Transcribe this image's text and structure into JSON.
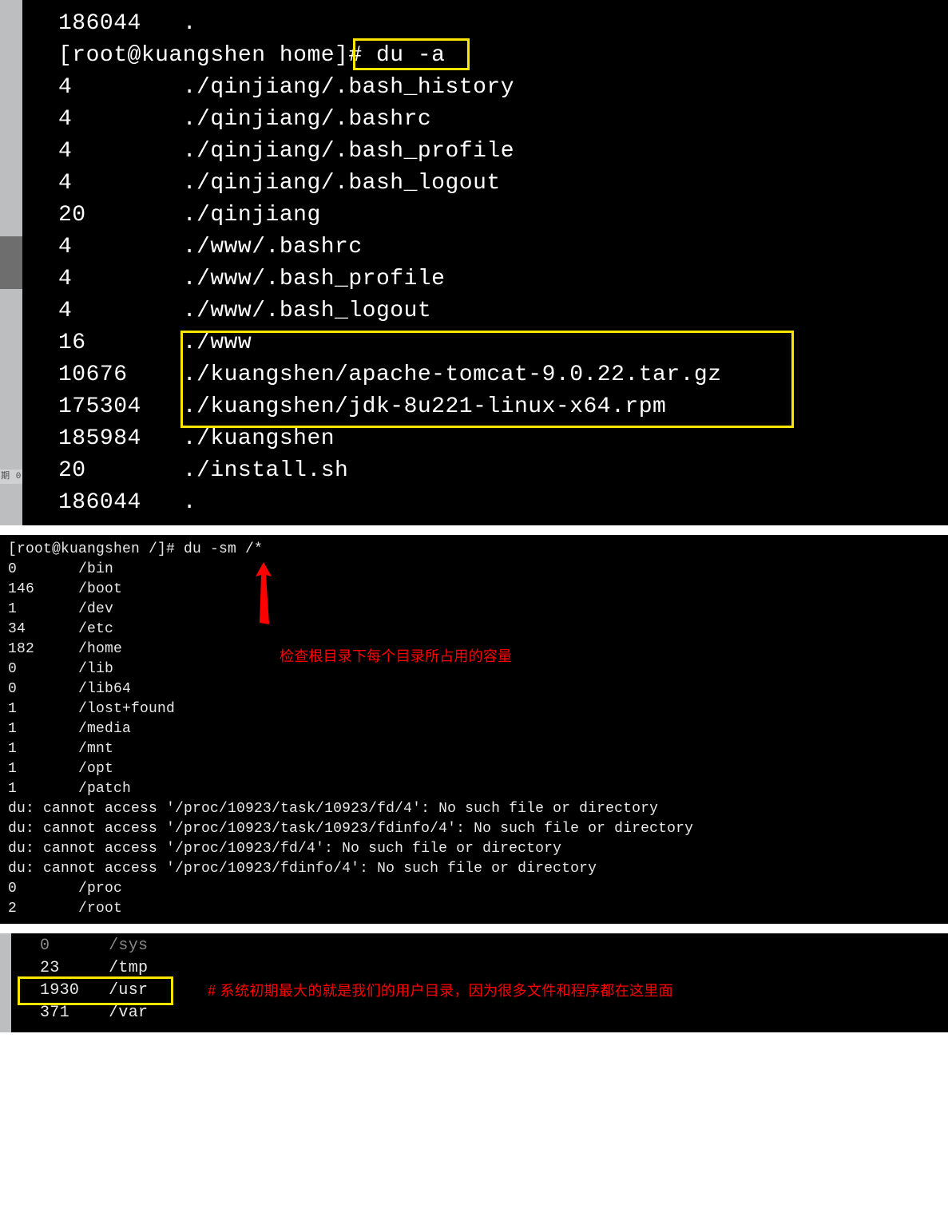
{
  "section1": {
    "sidebar_text": "期\n0",
    "lines": [
      {
        "size": "186044",
        "path": "."
      },
      {
        "prompt": "[root@kuangshen home]# ",
        "cmd": "du -a"
      },
      {
        "size": "4",
        "path": "./qinjiang/.bash_history"
      },
      {
        "size": "4",
        "path": "./qinjiang/.bashrc"
      },
      {
        "size": "4",
        "path": "./qinjiang/.bash_profile"
      },
      {
        "size": "4",
        "path": "./qinjiang/.bash_logout"
      },
      {
        "size": "20",
        "path": "./qinjiang"
      },
      {
        "size": "4",
        "path": "./www/.bashrc"
      },
      {
        "size": "4",
        "path": "./www/.bash_profile"
      },
      {
        "size": "4",
        "path": "./www/.bash_logout"
      },
      {
        "size": "16",
        "path": "./www"
      },
      {
        "size": "10676",
        "path": "./kuangshen/apache-tomcat-9.0.22.tar.gz"
      },
      {
        "size": "175304",
        "path": "./kuangshen/jdk-8u221-linux-x64.rpm"
      },
      {
        "size": "185984",
        "path": "./kuangshen"
      },
      {
        "size": "20",
        "path": "./install.sh"
      },
      {
        "size": "186044",
        "path": "."
      }
    ]
  },
  "section2": {
    "prompt": "[root@kuangshen /]# ",
    "cmd": "du -sm /*",
    "note": "检查根目录下每个目录所占用的容量",
    "rows": [
      {
        "size": "0",
        "path": "/bin"
      },
      {
        "size": "146",
        "path": "/boot"
      },
      {
        "size": "1",
        "path": "/dev"
      },
      {
        "size": "34",
        "path": "/etc"
      },
      {
        "size": "182",
        "path": "/home"
      },
      {
        "size": "0",
        "path": "/lib"
      },
      {
        "size": "0",
        "path": "/lib64"
      },
      {
        "size": "1",
        "path": "/lost+found"
      },
      {
        "size": "1",
        "path": "/media"
      },
      {
        "size": "1",
        "path": "/mnt"
      },
      {
        "size": "1",
        "path": "/opt"
      },
      {
        "size": "1",
        "path": "/patch"
      }
    ],
    "errors": [
      "du: cannot access '/proc/10923/task/10923/fd/4': No such file or directory",
      "du: cannot access '/proc/10923/task/10923/fdinfo/4': No such file or directory",
      "du: cannot access '/proc/10923/fd/4': No such file or directory",
      "du: cannot access '/proc/10923/fdinfo/4': No such file or directory"
    ],
    "rows2": [
      {
        "size": "0",
        "path": "/proc"
      },
      {
        "size": "2",
        "path": "/root"
      }
    ]
  },
  "section3": {
    "rows": [
      {
        "size": "0",
        "path": "/sys",
        "cut": true
      },
      {
        "size": "23",
        "path": "/tmp"
      },
      {
        "size": "1930",
        "path": "/usr"
      },
      {
        "size": "371",
        "path": "/var"
      }
    ],
    "note": "# 系统初期最大的就是我们的用户目录，因为很多文件和程序都在这里面"
  }
}
